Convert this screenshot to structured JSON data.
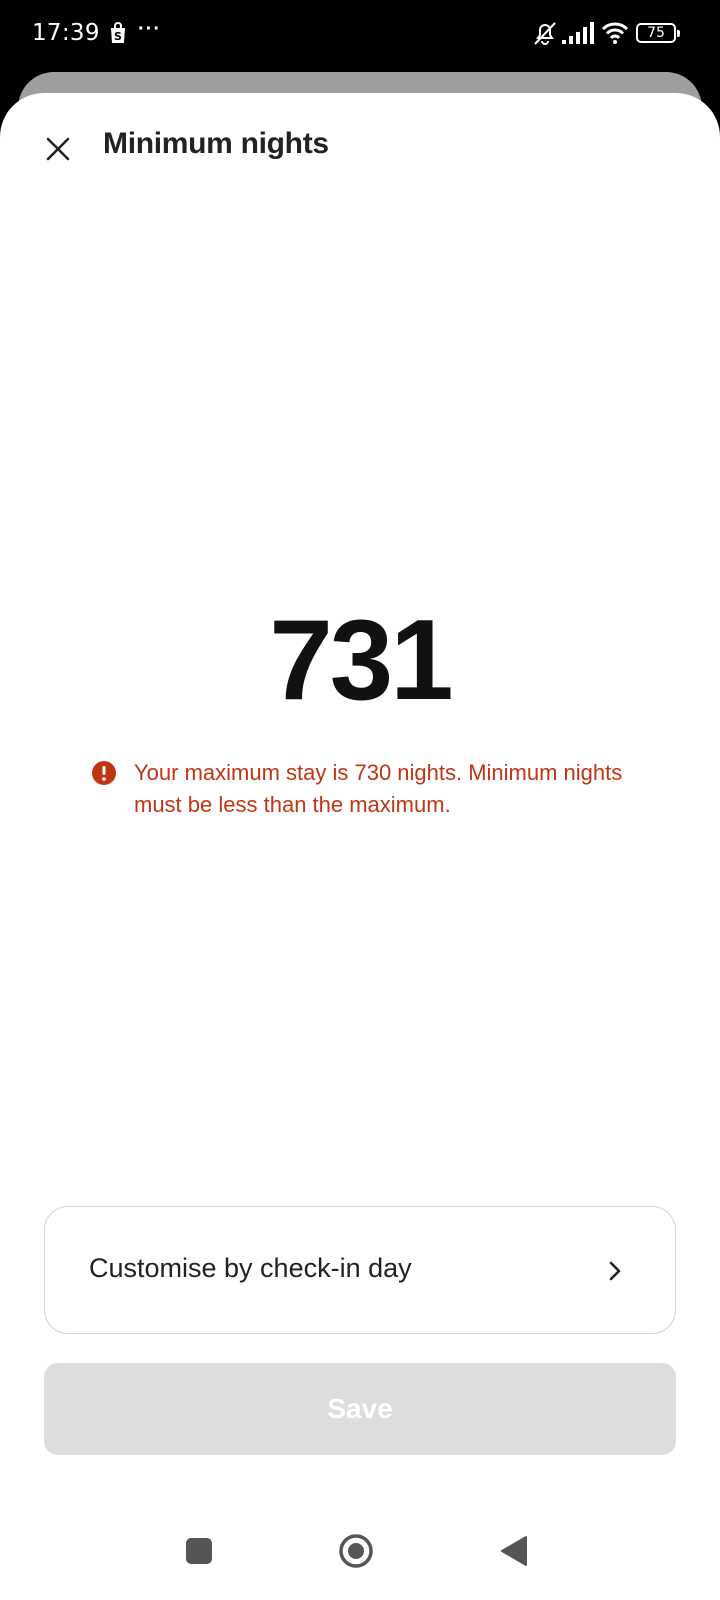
{
  "status_bar": {
    "time": "17:39",
    "more": "···",
    "battery_level": "75",
    "icons": [
      "shop-icon",
      "bell-off-icon",
      "signal-icon",
      "wifi-icon",
      "battery-icon"
    ]
  },
  "header": {
    "title": "Minimum nights",
    "close_icon": "close-icon"
  },
  "main": {
    "value": "731",
    "error_message": "Your maximum stay is 730 nights. Minimum nights must be less than the maximum.",
    "error_color": "#c13515"
  },
  "customise": {
    "label": "Customise by check-in day",
    "icon": "chevron-right-icon"
  },
  "save": {
    "label": "Save",
    "state": "disabled"
  },
  "nav_bar": {
    "icons": [
      "recents-icon",
      "home-icon",
      "back-icon"
    ]
  }
}
